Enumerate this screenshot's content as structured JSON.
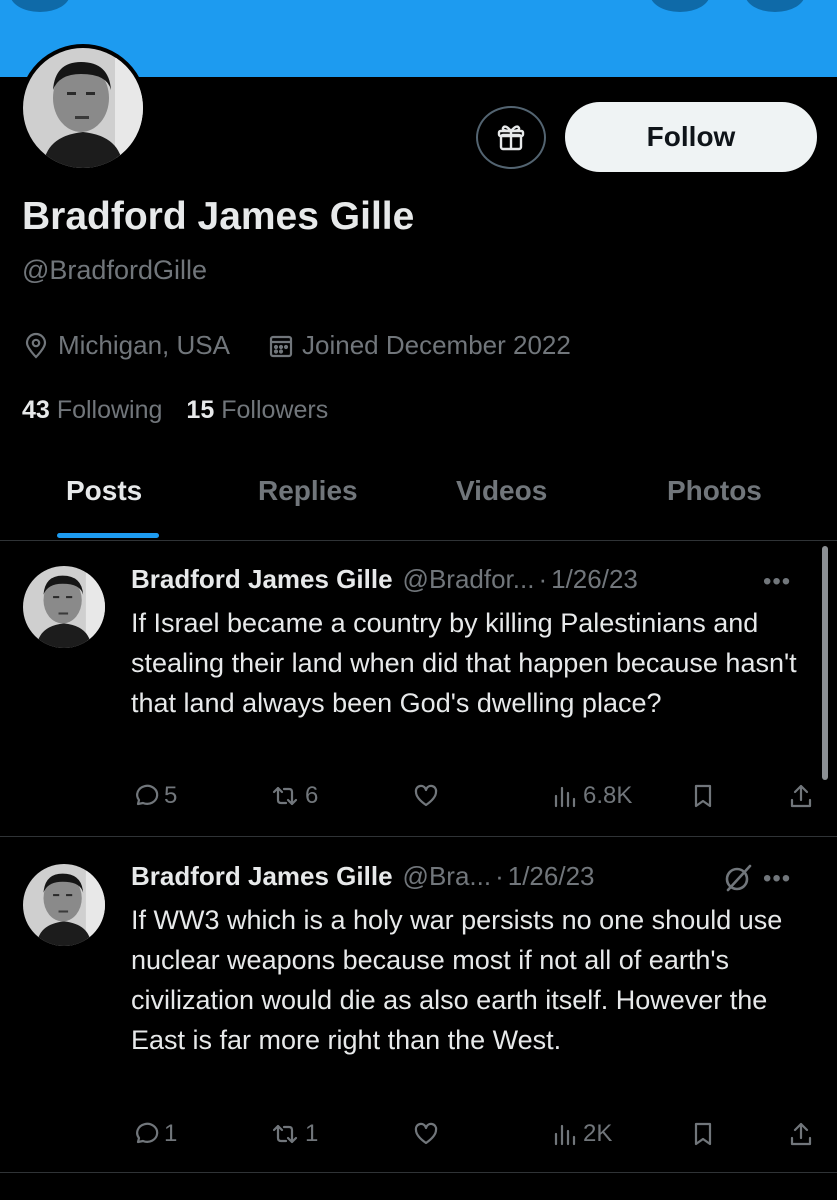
{
  "profile": {
    "display_name": "Bradford James Gille",
    "handle": "@BradfordGille",
    "location": "Michigan, USA",
    "joined": "Joined December 2022",
    "following_count": "43",
    "following_label": "Following",
    "followers_count": "15",
    "followers_label": "Followers",
    "follow_label": "Follow"
  },
  "tabs": [
    {
      "label": "Posts",
      "active": true
    },
    {
      "label": "Replies",
      "active": false
    },
    {
      "label": "Videos",
      "active": false
    },
    {
      "label": "Photos",
      "active": false
    }
  ],
  "posts": [
    {
      "author": "Bradford James Gille",
      "handle": "@Bradfor...",
      "date": "1/26/23",
      "text": "If Israel became a country by killing Palestinians and stealing their land when did that happen because hasn't that land always been God's dwelling place?",
      "replies": "5",
      "reposts": "6",
      "views": "6.8K"
    },
    {
      "author": "Bradford James Gille",
      "handle": "@Bra...",
      "date": "1/26/23",
      "text": "If WW3 which is a holy war persists no one should use nuclear weapons because most if not all of earth's civilization would die as also earth itself. However the East is far more right than the West.",
      "replies": "1",
      "reposts": "1",
      "views": "2K"
    }
  ],
  "colors": {
    "banner": "#1d9bf0",
    "background": "#000000",
    "text_primary": "#e7e9ea",
    "text_muted": "#71767b",
    "accent": "#1d9bf0",
    "follow_button": "#eff3f4"
  },
  "icons": [
    "gift-icon",
    "location-pin-icon",
    "calendar-icon",
    "reply-icon",
    "repost-icon",
    "like-icon",
    "views-icon",
    "bookmark-icon",
    "share-icon",
    "more-icon",
    "grok-icon"
  ]
}
